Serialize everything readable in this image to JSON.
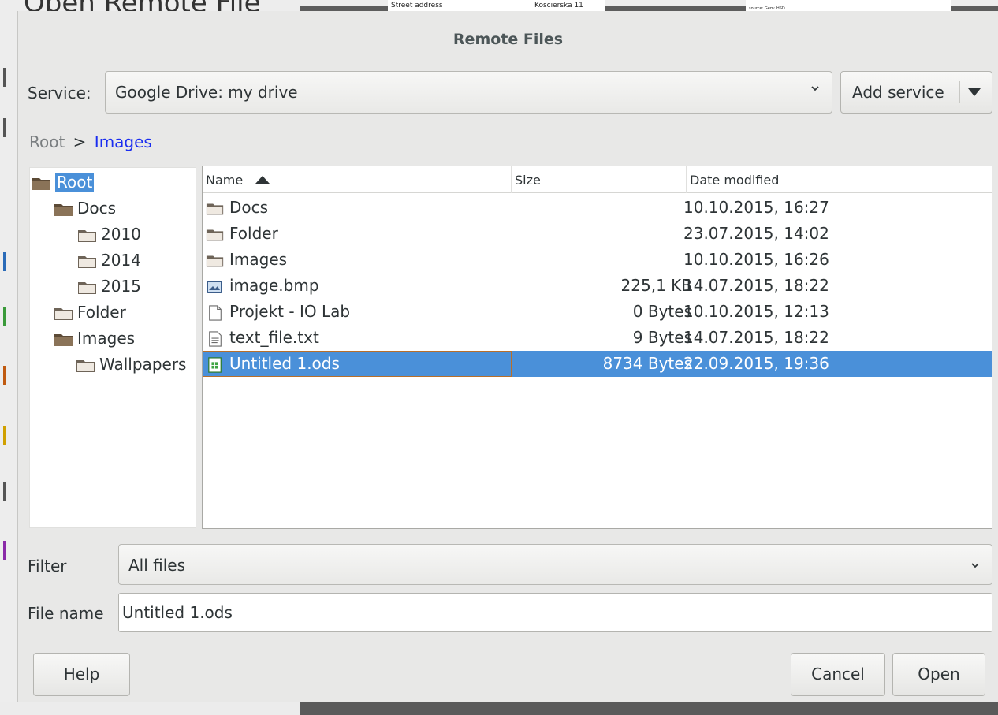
{
  "background": {
    "ghost_title": "Open Remote File",
    "cells": [
      "Street address",
      "Koscierska 11",
      "source: Gem: HSD"
    ]
  },
  "dialog": {
    "title": "Remote Files",
    "service_label": "Service:",
    "service_value": "Google Drive: my drive",
    "add_service_label": "Add service",
    "breadcrumb": {
      "root": "Root",
      "separator": ">",
      "current": "Images"
    },
    "tree": [
      {
        "label": "Root",
        "selected": true
      },
      {
        "label": "Docs"
      },
      {
        "label": "2010"
      },
      {
        "label": "2014"
      },
      {
        "label": "2015"
      },
      {
        "label": "Folder"
      },
      {
        "label": "Images"
      },
      {
        "label": "Wallpapers"
      }
    ],
    "columns": {
      "name": "Name",
      "size": "Size",
      "date": "Date modified"
    },
    "files": [
      {
        "name": "Docs",
        "size": "",
        "date": "10.10.2015, 16:27",
        "icon": "folder-icon"
      },
      {
        "name": "Folder",
        "size": "",
        "date": "23.07.2015, 14:02",
        "icon": "folder-icon"
      },
      {
        "name": "Images",
        "size": "",
        "date": "10.10.2015, 16:26",
        "icon": "folder-icon"
      },
      {
        "name": "image.bmp",
        "size": "225,1 KB",
        "date": "14.07.2015, 18:22",
        "icon": "image-file-icon"
      },
      {
        "name": "Projekt - IO Lab",
        "size": "0 Bytes",
        "date": "10.10.2015, 12:13",
        "icon": "blank-file-icon"
      },
      {
        "name": "text_file.txt",
        "size": "9 Bytes",
        "date": "14.07.2015, 18:22",
        "icon": "text-file-icon"
      },
      {
        "name": "Untitled 1.ods",
        "size": "8734 Bytes",
        "date": "22.09.2015, 19:36",
        "icon": "spreadsheet-file-icon",
        "selected": true
      }
    ],
    "filter_label": "Filter",
    "filter_value": "All files",
    "filename_label": "File name",
    "filename_value": "Untitled 1.ods",
    "help_label": "Help",
    "cancel_label": "Cancel",
    "open_label": "Open"
  },
  "colors": {
    "selection": "#4a90d9",
    "link": "#1a2df0"
  }
}
